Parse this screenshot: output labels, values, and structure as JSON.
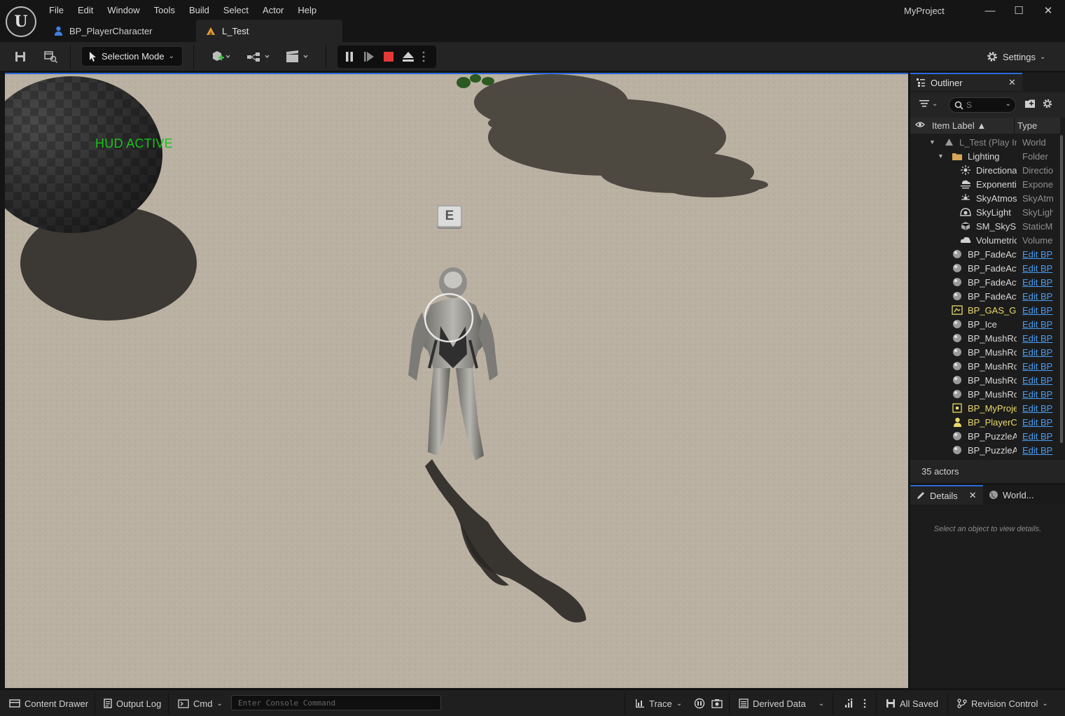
{
  "app": {
    "project_name": "MyProject",
    "logo_glyph": "U"
  },
  "menu": [
    "File",
    "Edit",
    "Window",
    "Tools",
    "Build",
    "Select",
    "Actor",
    "Help"
  ],
  "window_controls": {
    "minimize": "—",
    "maximize": "☐",
    "close": "✕"
  },
  "tabs": [
    {
      "label": "BP_PlayerCharacter",
      "icon": "person-icon",
      "active": false
    },
    {
      "label": "L_Test",
      "icon": "level-icon",
      "active": true
    }
  ],
  "toolbar": {
    "selection_mode": "Selection Mode",
    "settings": "Settings",
    "play_controls": [
      "pause",
      "step",
      "stop",
      "eject",
      "more"
    ]
  },
  "viewport": {
    "hud_text": "HUD ACTIVE",
    "key_prompt": "E",
    "hud_color": "#18c21a"
  },
  "outliner": {
    "title": "Outliner",
    "search_placeholder": "S",
    "columns": {
      "label": "Item Label ▲",
      "type": "Type"
    },
    "rows": [
      {
        "label": "L_Test (Play In Editor)",
        "type": "World",
        "icon": "level-icon",
        "depth": 0,
        "arrow": "▼",
        "dim": true
      },
      {
        "label": "Lighting",
        "type": "Folder",
        "icon": "folder-icon",
        "depth": 1,
        "arrow": "▼"
      },
      {
        "label": "DirectionalLight",
        "type": "DirectionalLight",
        "icon": "sun-icon",
        "depth": 2
      },
      {
        "label": "ExponentialHeightFog",
        "type": "ExponentialHeightFog",
        "icon": "fog-icon",
        "depth": 2
      },
      {
        "label": "SkyAtmosphere",
        "type": "SkyAtmosphere",
        "icon": "atmosphere-icon",
        "depth": 2
      },
      {
        "label": "SkyLight",
        "type": "SkyLight",
        "icon": "skylight-icon",
        "depth": 2
      },
      {
        "label": "SM_SkySphere",
        "type": "StaticMeshActor",
        "icon": "cube-icon",
        "depth": 2
      },
      {
        "label": "VolumetricCloud",
        "type": "VolumetricCloud",
        "icon": "cloud-icon",
        "depth": 2
      },
      {
        "label": "BP_FadeActor",
        "type": "Edit BP",
        "icon": "actor-icon",
        "depth": 1,
        "link": true
      },
      {
        "label": "BP_FadeActor",
        "type": "Edit BP",
        "icon": "actor-icon",
        "depth": 1,
        "link": true
      },
      {
        "label": "BP_FadeActor",
        "type": "Edit BP",
        "icon": "actor-icon",
        "depth": 1,
        "link": true
      },
      {
        "label": "BP_FadeActor",
        "type": "Edit BP",
        "icon": "actor-icon",
        "depth": 1,
        "link": true
      },
      {
        "label": "BP_GAS_GameMode",
        "type": "Edit BP",
        "icon": "gamemode-icon",
        "depth": 1,
        "link": true,
        "highlight": true
      },
      {
        "label": "BP_Ice",
        "type": "Edit BP",
        "icon": "actor-icon",
        "depth": 1,
        "link": true
      },
      {
        "label": "BP_MushRoom",
        "type": "Edit BP",
        "icon": "actor-icon",
        "depth": 1,
        "link": true
      },
      {
        "label": "BP_MushRoom",
        "type": "Edit BP",
        "icon": "actor-icon",
        "depth": 1,
        "link": true
      },
      {
        "label": "BP_MushRoom",
        "type": "Edit BP",
        "icon": "actor-icon",
        "depth": 1,
        "link": true
      },
      {
        "label": "BP_MushRoom",
        "type": "Edit BP",
        "icon": "actor-icon",
        "depth": 1,
        "link": true
      },
      {
        "label": "BP_MushRoom",
        "type": "Edit BP",
        "icon": "actor-icon",
        "depth": 1,
        "link": true
      },
      {
        "label": "BP_MyProjectHUD",
        "type": "Edit BP",
        "icon": "hud-icon",
        "depth": 1,
        "link": true,
        "highlight": true
      },
      {
        "label": "BP_PlayerCharacter",
        "type": "Edit BP",
        "icon": "pawn-icon",
        "depth": 1,
        "link": true,
        "highlight": true
      },
      {
        "label": "BP_PuzzleActor",
        "type": "Edit BP",
        "icon": "actor-icon",
        "depth": 1,
        "link": true
      },
      {
        "label": "BP_PuzzleActor",
        "type": "Edit BP",
        "icon": "actor-icon",
        "depth": 1,
        "link": true
      }
    ],
    "actor_count": "35 actors"
  },
  "details": {
    "tab_details": "Details",
    "tab_world": "World...",
    "empty_message": "Select an object to view details."
  },
  "statusbar": {
    "content_drawer": "Content Drawer",
    "output_log": "Output Log",
    "cmd": "Cmd",
    "console_placeholder": "Enter Console Command",
    "trace": "Trace",
    "derived_data": "Derived Data",
    "all_saved": "All Saved",
    "revision_control": "Revision Control"
  },
  "colors": {
    "accent_blue": "#2a6ad8",
    "stop_red": "#e53935",
    "link_blue": "#4b9cf0",
    "highlight_yellow": "#e8d96a"
  }
}
